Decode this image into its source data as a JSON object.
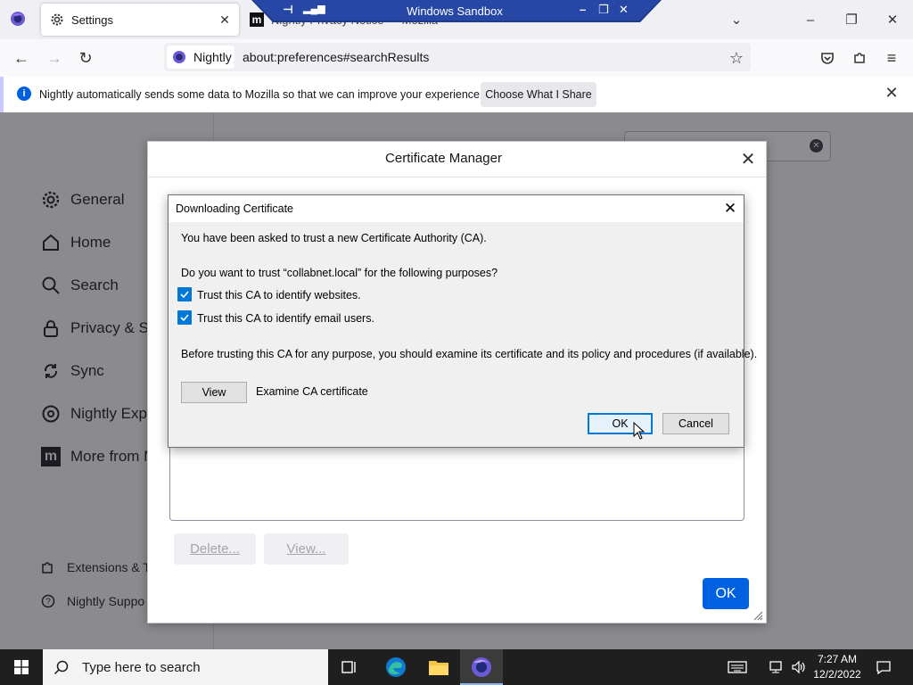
{
  "browser": {
    "tabs": [
      {
        "label": "Settings"
      },
      {
        "label": "Nightly Privacy Notice — Mozilla"
      }
    ],
    "nav": {
      "identity_label": "Nightly",
      "url": "about:preferences#searchResults"
    }
  },
  "sandbox": {
    "title": "Windows Sandbox"
  },
  "notification": {
    "text": "Nightly automatically sends some data to Mozilla so that we can improve your experience.",
    "button": "Choose What I Share"
  },
  "settings": {
    "categories": [
      {
        "label": "General",
        "icon": "gear-icon"
      },
      {
        "label": "Home",
        "icon": "home-icon"
      },
      {
        "label": "Search",
        "icon": "search-icon"
      },
      {
        "label": "Privacy & Se",
        "icon": "lock-icon"
      },
      {
        "label": "Sync",
        "icon": "sync-icon"
      },
      {
        "label": "Nightly Expe",
        "icon": "flask-icon"
      },
      {
        "label": "More from M",
        "icon": "mozilla-icon"
      }
    ],
    "footer_links": [
      {
        "label": "Extensions & T",
        "icon": "puzzle-icon"
      },
      {
        "label": "Nightly Suppo",
        "icon": "help-icon"
      }
    ]
  },
  "certificate_manager": {
    "title": "Certificate Manager",
    "buttons": {
      "delete": "Delete...",
      "view": "View...",
      "ok": "OK"
    }
  },
  "download_dialog": {
    "title": "Downloading Certificate",
    "intro": "You have been asked to trust a new Certificate Authority (CA).",
    "question": "Do you want to trust “collabnet.local” for the following purposes?",
    "options": [
      {
        "label": "Trust this CA to identify websites.",
        "checked": true
      },
      {
        "label": "Trust this CA to identify email users.",
        "checked": true
      }
    ],
    "advice": "Before trusting this CA for any purpose, you should examine its certificate and its policy and procedures (if available).",
    "view_button": "View",
    "view_label": "Examine CA certificate",
    "ok_button": "OK",
    "cancel_button": "Cancel"
  },
  "taskbar": {
    "search_placeholder": "Type here to search",
    "time": "7:27 AM",
    "date": "12/2/2022"
  },
  "colors": {
    "accent": "#0061e0",
    "checkbox": "#0078d7",
    "sandbox_bar": "#1e3a8a",
    "taskbar": "#1f1f1f"
  }
}
